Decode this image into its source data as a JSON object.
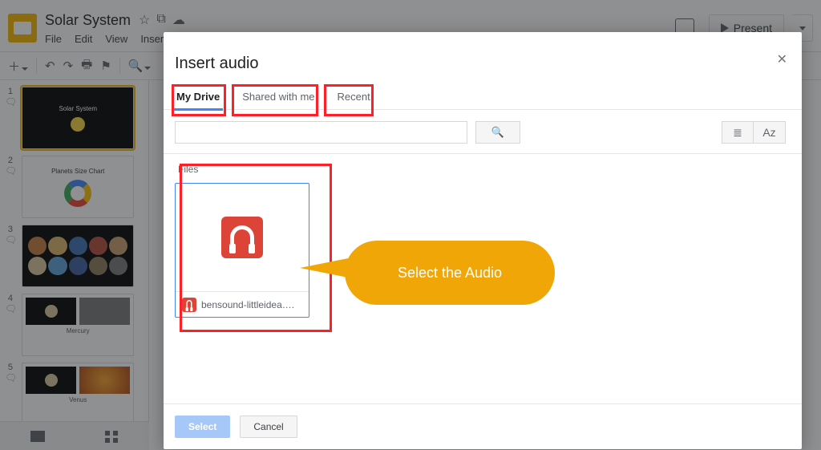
{
  "header": {
    "title": "Solar System",
    "menu": [
      "File",
      "Edit",
      "View",
      "Insert"
    ],
    "present_label": "Present"
  },
  "slides": [
    {
      "num": "1",
      "title": "Solar System"
    },
    {
      "num": "2",
      "title": "Planets Size Chart"
    },
    {
      "num": "3",
      "title": ""
    },
    {
      "num": "4",
      "title": "Mercury"
    },
    {
      "num": "5",
      "title": "Venus"
    }
  ],
  "dialog": {
    "title": "Insert audio",
    "tabs": [
      "My Drive",
      "Shared with me",
      "Recent"
    ],
    "active_tab": 0,
    "files_label": "Files",
    "file": {
      "name": "bensound-littleidea…."
    },
    "select_label": "Select",
    "cancel_label": "Cancel",
    "close_glyph": "✕"
  },
  "callout": {
    "text": "Select the Audio"
  },
  "icons": {
    "search": "🔍",
    "list": "≣",
    "sort": "Aᴢ",
    "star": "☆",
    "move": "⧉",
    "cloud": "☁"
  }
}
